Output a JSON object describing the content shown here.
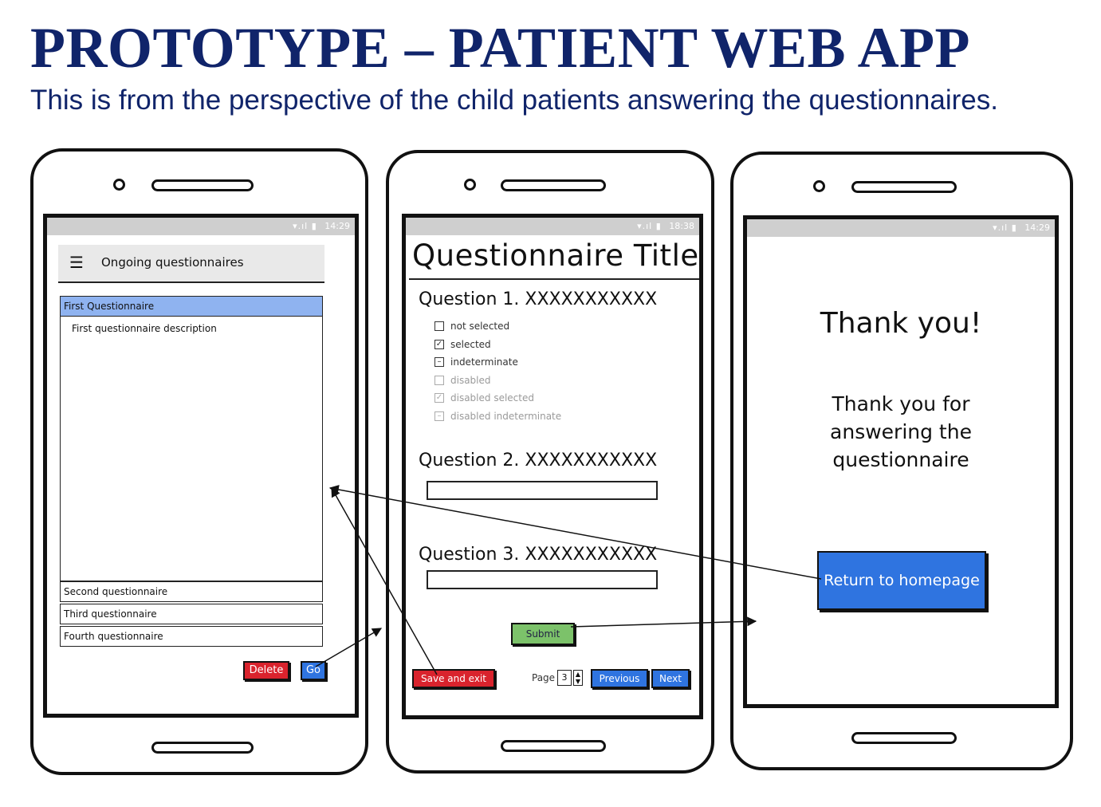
{
  "slide": {
    "title": "PROTOTYPE – PATIENT WEB APP",
    "subtitle": "This is from the perspective of the child patients answering the questionnaires."
  },
  "phone1": {
    "status_time": "14:29",
    "appbar_title": "Ongoing questionnaires",
    "menu_icon": "hamburger-menu-icon",
    "questionnaires": [
      {
        "label": "First Questionnaire",
        "selected": true,
        "description": "First questionnaire description"
      },
      {
        "label": "Second questionnaire"
      },
      {
        "label": "Third questionnaire"
      },
      {
        "label": "Fourth questionnaire"
      }
    ],
    "delete_label": "Delete",
    "go_label": "Go"
  },
  "phone2": {
    "status_time": "18:38",
    "title": "Questionnaire Title",
    "question1": "Question 1. XXXXXXXXXXX",
    "checkboxes": [
      {
        "label": "not selected",
        "state": "unchecked",
        "disabled": false
      },
      {
        "label": "selected",
        "state": "checked",
        "disabled": false
      },
      {
        "label": "indeterminate",
        "state": "indeterminate",
        "disabled": false
      },
      {
        "label": "disabled",
        "state": "unchecked",
        "disabled": true
      },
      {
        "label": "disabled selected",
        "state": "checked",
        "disabled": true
      },
      {
        "label": "disabled indeterminate",
        "state": "indeterminate",
        "disabled": true
      }
    ],
    "question2": "Question 2. XXXXXXXXXXX",
    "question3": "Question 3. XXXXXXXXXXX",
    "submit_label": "Submit",
    "save_exit_label": "Save and exit",
    "page_label": "Page",
    "page_value": "3",
    "previous_label": "Previous",
    "next_label": "Next"
  },
  "phone3": {
    "status_time": "14:29",
    "thanks_title": "Thank you!",
    "thanks_line1": "Thank you for",
    "thanks_line2": "answering the",
    "thanks_line3": "questionnaire",
    "return_label": "Return to homepage"
  },
  "colors": {
    "title": "#10246a",
    "selected_row": "#8fb3f0",
    "button_red": "#d9232d",
    "button_blue": "#2f74e0",
    "button_green": "#7cc26a"
  }
}
